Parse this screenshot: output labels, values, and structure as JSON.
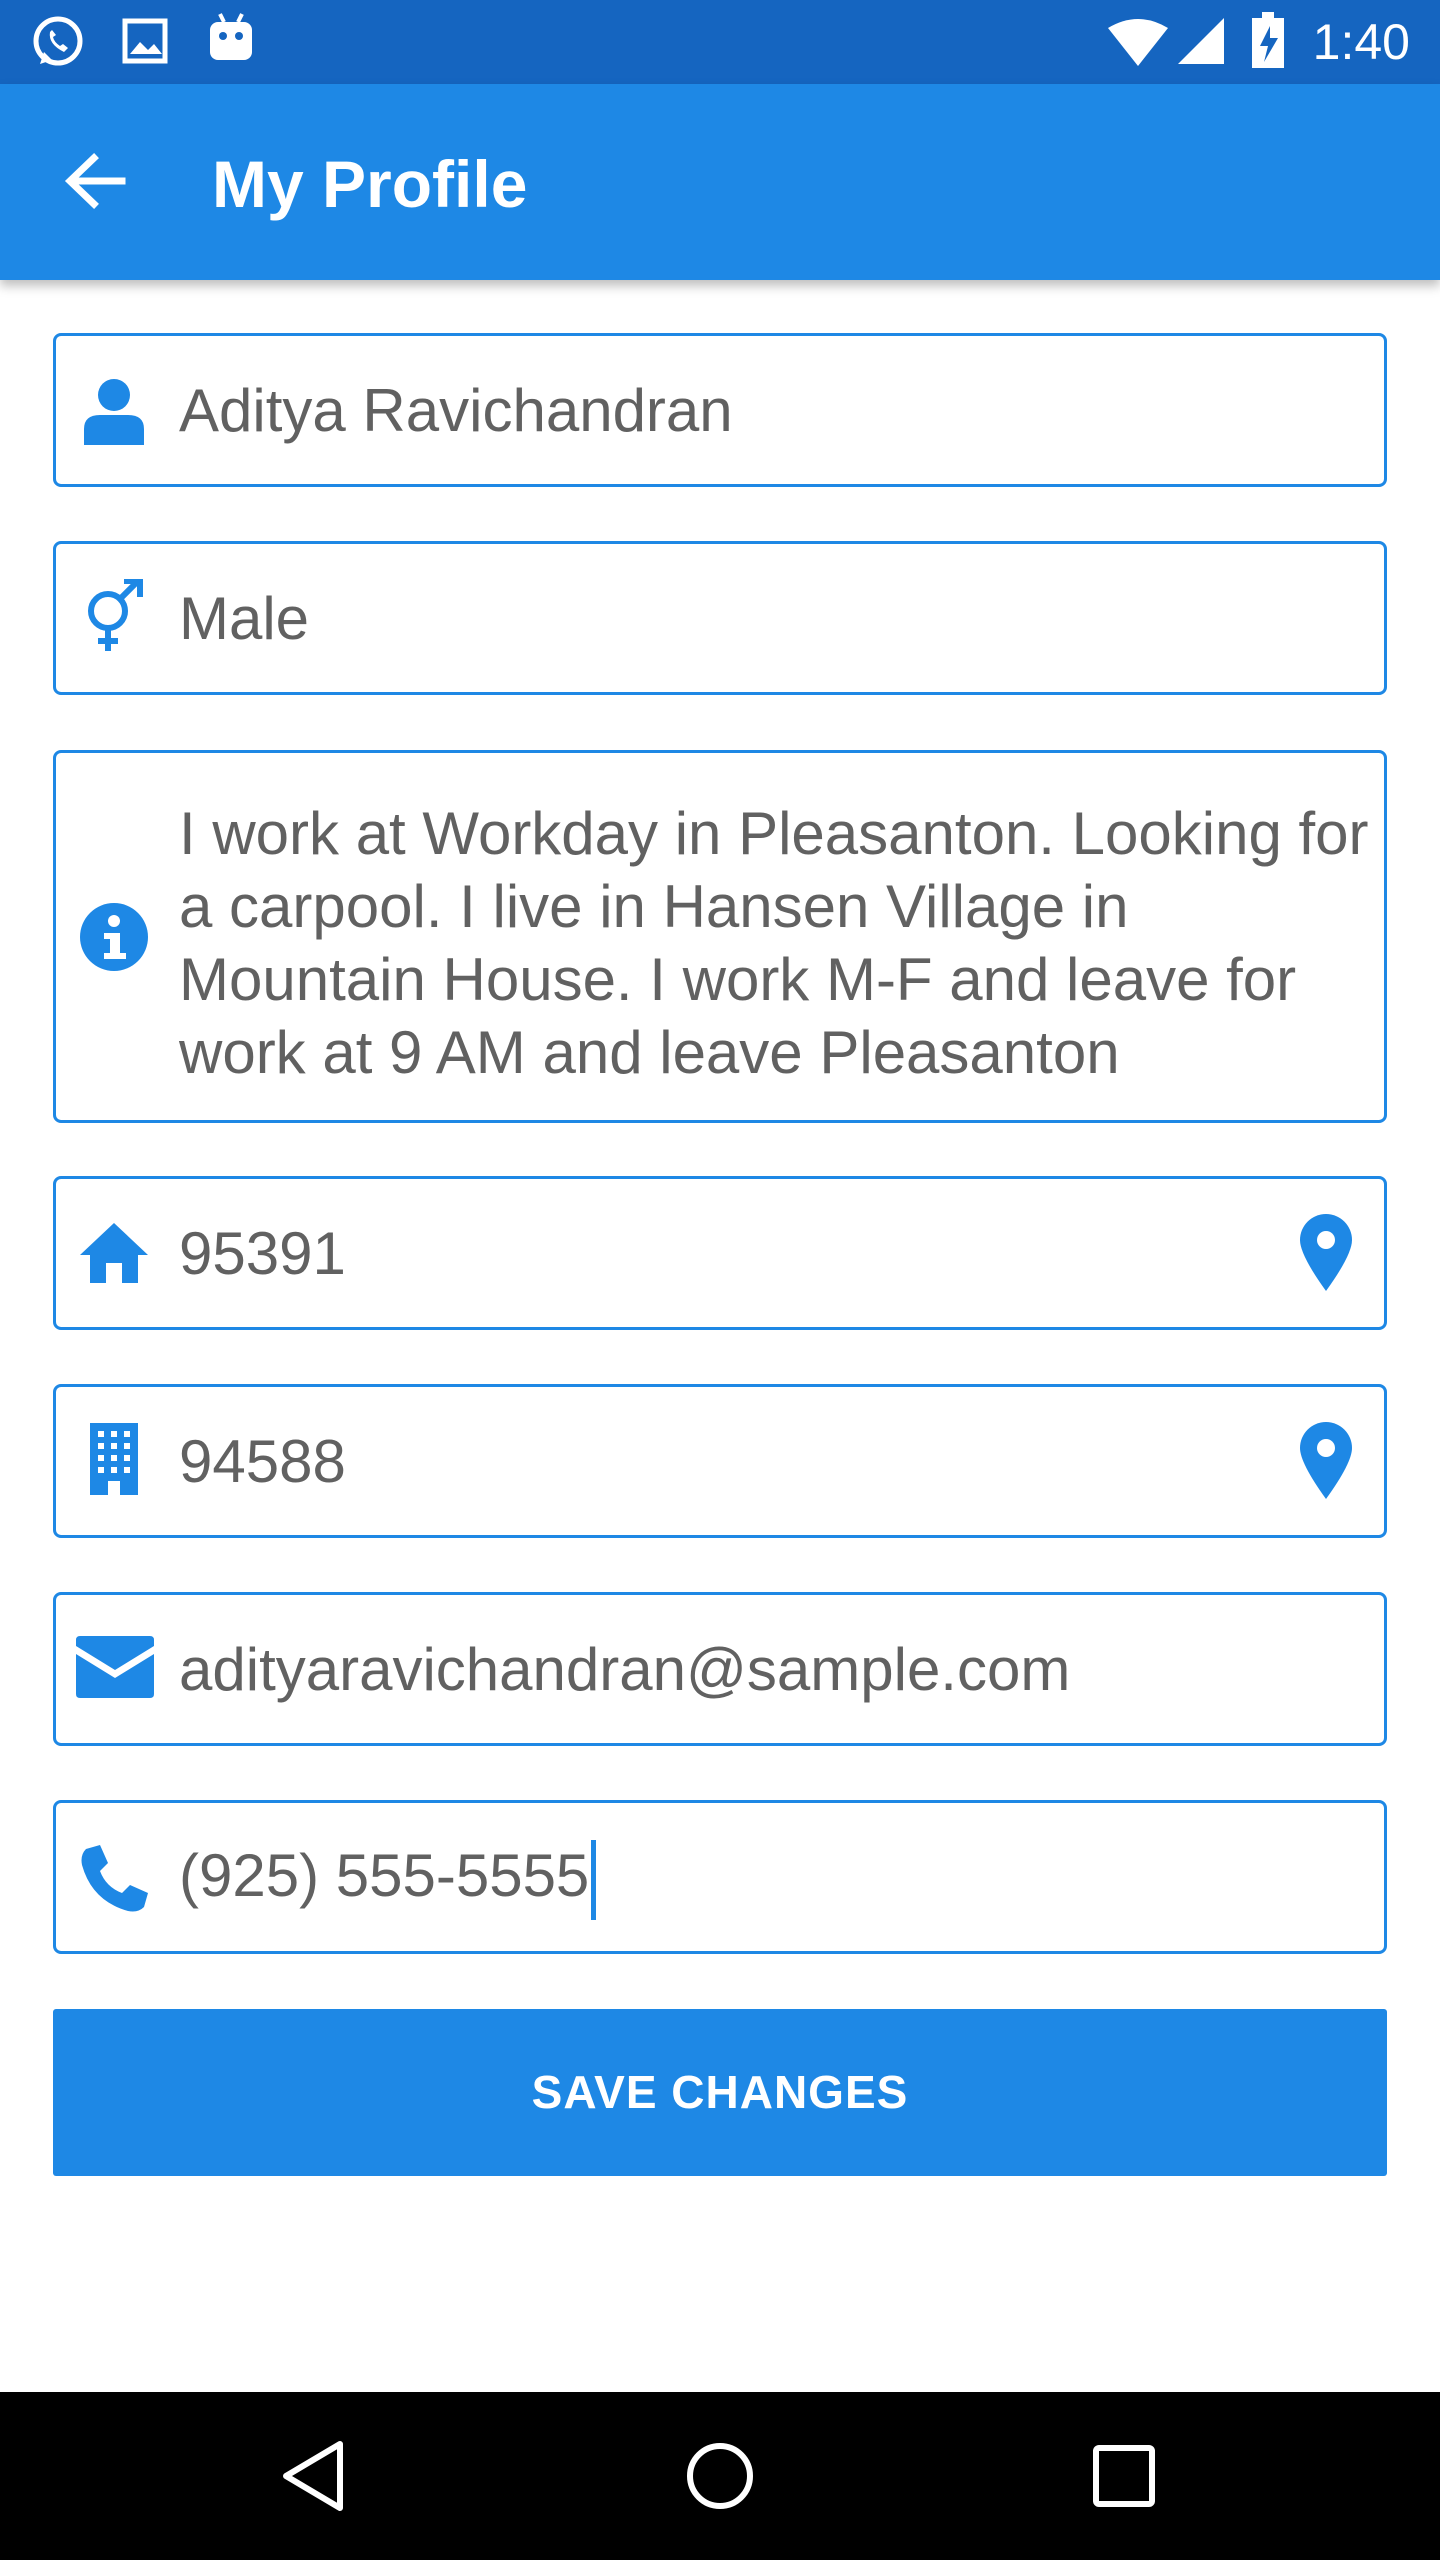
{
  "status_bar": {
    "time": "1:40",
    "left_icons": [
      "whatsapp-icon",
      "image-icon",
      "android-icon"
    ],
    "right_icons": [
      "wifi-icon",
      "signal-icon",
      "battery-charging-icon"
    ]
  },
  "app_bar": {
    "title": "My Profile",
    "back_icon": "arrow-back-icon"
  },
  "form": {
    "name": {
      "icon": "person-icon",
      "value": "Aditya Ravichandran"
    },
    "gender": {
      "icon": "gender-icon",
      "value": "Male"
    },
    "bio": {
      "icon": "info-icon",
      "value": "I work at Workday in Pleasanton. Looking for a carpool. I live in Hansen Village in Mountain House. I work M-F and leave for work at 9 AM and leave Pleasanton"
    },
    "home_zip": {
      "icon": "home-icon",
      "value": "95391",
      "action_icon": "location-pin-icon"
    },
    "work_zip": {
      "icon": "building-icon",
      "value": "94588",
      "action_icon": "location-pin-icon"
    },
    "email": {
      "icon": "email-icon",
      "value": "adityaravichandran@sample.com"
    },
    "phone": {
      "icon": "phone-icon",
      "value": "(925) 555-5555"
    }
  },
  "save_button": {
    "label": "SAVE CHANGES"
  },
  "nav_bar": {
    "icons": [
      "back-nav-icon",
      "home-nav-icon",
      "recents-nav-icon"
    ]
  },
  "colors": {
    "status_bar": "#1565c0",
    "app_bar": "#1e88e5",
    "accent": "#1e88e5",
    "field_text": "#616161",
    "nav_bar": "#000000"
  }
}
